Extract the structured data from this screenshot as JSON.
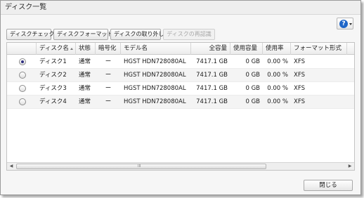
{
  "window": {
    "title": "ディスク一覧"
  },
  "help": {
    "glyph": "?"
  },
  "toolbar": {
    "check": "ディスクチェック",
    "format": "ディスクフォーマット",
    "remove": "ディスクの取り外し",
    "reauth": "ディスクの再認識"
  },
  "table": {
    "headers": {
      "name": "ディスク名",
      "status": "状態",
      "encryption": "暗号化",
      "model": "モデル名",
      "capacity": "全容量",
      "used": "使用容量",
      "usage": "使用率",
      "format": "フォーマット形式"
    },
    "rows": [
      {
        "selected": true,
        "name": "ディスク1",
        "status": "通常",
        "encryption": "ー",
        "model": "HGST HDN728080AL",
        "capacity": "7417.1 GB",
        "used": "0 GB",
        "usage": "0.00 %",
        "format": "XFS"
      },
      {
        "selected": false,
        "name": "ディスク2",
        "status": "通常",
        "encryption": "ー",
        "model": "HGST HDN728080AL",
        "capacity": "7417.1 GB",
        "used": "0 GB",
        "usage": "0.00 %",
        "format": "XFS"
      },
      {
        "selected": false,
        "name": "ディスク3",
        "status": "通常",
        "encryption": "ー",
        "model": "HGST HDN728080AL",
        "capacity": "7417.1 GB",
        "used": "0 GB",
        "usage": "0.00 %",
        "format": "XFS"
      },
      {
        "selected": false,
        "name": "ディスク4",
        "status": "通常",
        "encryption": "ー",
        "model": "HGST HDN728080AL",
        "capacity": "7417.1 GB",
        "used": "0 GB",
        "usage": "0.00 %",
        "format": "XFS"
      }
    ]
  },
  "scrollbar": {
    "left_arrow": "◀",
    "right_arrow": "▶",
    "grip": "III"
  },
  "footer": {
    "close": "閉じる"
  }
}
